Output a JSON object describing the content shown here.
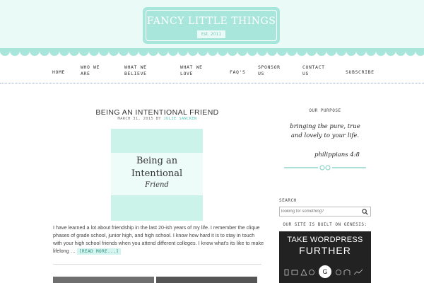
{
  "header": {
    "logo_title": "FANCY LITTLE THINGS",
    "logo_est": "Est. 2011"
  },
  "nav": {
    "items": [
      {
        "label": "HOME"
      },
      {
        "label": "WHO WE\nARE"
      },
      {
        "label": "WHAT WE\nBELIEVE"
      },
      {
        "label": "WHAT WE\nLOVE"
      },
      {
        "label": "FAQ'S"
      },
      {
        "label": "SPONSOR\nUS"
      },
      {
        "label": "CONTACT\nUS"
      },
      {
        "label": "SUBSCRIBE"
      }
    ]
  },
  "post": {
    "title": "BEING AN INTENTIONAL FRIEND",
    "date": "MARCH 31, 2015",
    "by": "BY",
    "author": "JULIE SANCKEN",
    "image_line1": "Being an",
    "image_line2": "Intentional",
    "image_line3": "Friend",
    "excerpt": "I have learned a lot about friendship in the last 20-ish years of my life. I remember the clique phases of grade school, junior high, and high school. I know how hard it is to stay in touch with your high school friends when you attend different colleges. I know what's its like to make lifelong …",
    "read_more": "[READ MORE...]"
  },
  "sidebar": {
    "purpose_heading": "OUR PURPOSE",
    "purpose_line1": "bringing the pure, true",
    "purpose_line2": "and lovely to your life.",
    "purpose_ref": "philippians 4:8",
    "search_label": "SEARCH",
    "search_placeholder": "looking for something?",
    "genesis_heading": "OUR SITE IS BUILT ON GENESIS:",
    "genesis_line1": "TAKE WORDPRESS",
    "genesis_line2": "FURTHER",
    "genesis_logo": "G"
  },
  "colors": {
    "header_bg": "#e9faf7",
    "badge": "#a8e6dc",
    "accent": "#5cc9b6",
    "featured_bg": "#ccf3ea",
    "banner_bg": "#222222"
  }
}
